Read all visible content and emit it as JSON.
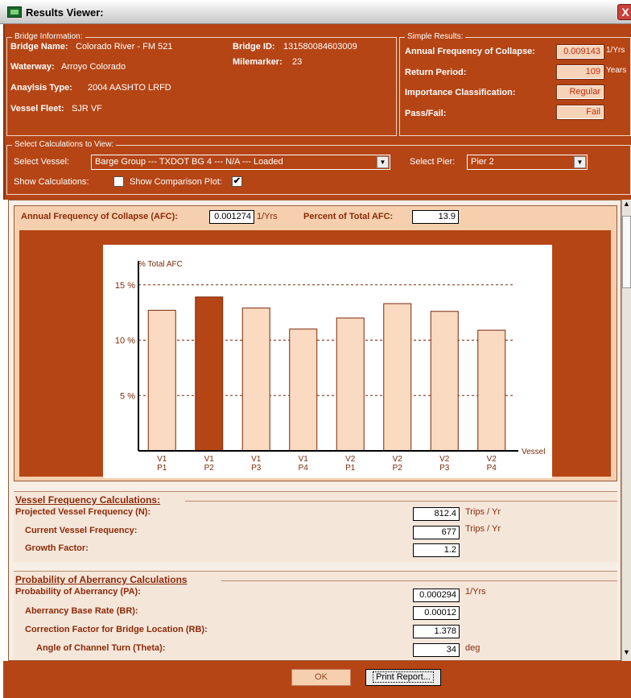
{
  "window": {
    "title": "Results Viewer:",
    "close_glyph": "X"
  },
  "bridge_info": {
    "group_title": "Bridge Information:",
    "name_label": "Bridge Name:",
    "name_value": "Colorado River - FM 521",
    "id_label": "Bridge ID:",
    "id_value": "131580084603009",
    "waterway_label": "Waterway:",
    "waterway_value": "Arroyo Colorado",
    "milemarker_label": "Milemarker:",
    "milemarker_value": "23",
    "analysis_label": "Anaylsis Type:",
    "analysis_value": "2004 AASHTO LRFD",
    "fleet_label": "Vessel Fleet:",
    "fleet_value": "SJR VF"
  },
  "simple_results": {
    "group_title": "Simple Results:",
    "afc_label": "Annual Frequency of Collapse:",
    "afc_value": "0.009143",
    "afc_unit": "1/Yrs",
    "return_label": "Return Period:",
    "return_value": "109",
    "return_unit": "Years",
    "importance_label": "Importance Classification:",
    "importance_value": "Regular",
    "passfail_label": "Pass/Fail:",
    "passfail_value": "Fail"
  },
  "select_calcs": {
    "group_title": "Select Calculations to View:",
    "vessel_label": "Select Vessel:",
    "vessel_value": "Barge Group --- TXDOT BG 4 --- N/A --- Loaded",
    "pier_label": "Select Pier:",
    "pier_value": "Pier 2",
    "show_calc_label": "Show Calculations:",
    "show_calc_checked": false,
    "show_comp_label": "Show Comparison Plot:",
    "show_comp_checked": true,
    "check_glyph": "✔"
  },
  "afc_panel": {
    "afc_label": "Annual Frequency of Collapse (AFC):",
    "afc_value": "0.001274",
    "afc_unit": "1/Yrs",
    "pct_label": "Percent of Total AFC:",
    "pct_value": "13.9"
  },
  "chart_data": {
    "type": "bar",
    "ylabel": "% Total AFC",
    "xlabel": "Vessel",
    "ylim": [
      0,
      16
    ],
    "yticks": [
      5,
      10,
      15
    ],
    "ytick_labels": [
      "5 %",
      "10 %",
      "15 %"
    ],
    "grid": "horizontal dashed",
    "categories": [
      {
        "top": "V1",
        "bottom": "P1"
      },
      {
        "top": "V1",
        "bottom": "P2"
      },
      {
        "top": "V1",
        "bottom": "P3"
      },
      {
        "top": "V1",
        "bottom": "P4"
      },
      {
        "top": "V2",
        "bottom": "P1"
      },
      {
        "top": "V2",
        "bottom": "P2"
      },
      {
        "top": "V2",
        "bottom": "P3"
      },
      {
        "top": "V2",
        "bottom": "P4"
      }
    ],
    "values": [
      12.7,
      13.9,
      12.9,
      11.0,
      12.0,
      13.3,
      12.6,
      10.9
    ],
    "highlight_index": 1,
    "colors": {
      "bar": "#fadac0",
      "highlight": "#b54515",
      "edge": "#7a2a08"
    }
  },
  "vessel_freq": {
    "title": "Vessel Frequency Calculations:",
    "rows": [
      {
        "label": "Projected Vessel Frequency (N):",
        "value": "812.4",
        "unit": "Trips / Yr"
      },
      {
        "label": "Current Vessel Frequency:",
        "value": "677",
        "unit": "Trips / Yr"
      },
      {
        "label": "Growth Factor:",
        "value": "1.2",
        "unit": ""
      }
    ]
  },
  "aberrancy": {
    "title": "Probability of Aberrancy Calculations",
    "rows": [
      {
        "label": "Probability of Aberrancy (PA):",
        "value": "0.000294",
        "unit": "1/Yrs"
      },
      {
        "label": "Aberrancy Base Rate (BR):",
        "value": "0.00012",
        "unit": ""
      },
      {
        "label": "Correction Factor for Bridge Location (RB):",
        "value": "1.378",
        "unit": ""
      },
      {
        "label": "Angle of Channel Turn (Theta):",
        "value": "34",
        "unit": "deg"
      }
    ]
  },
  "buttons": {
    "ok": "OK",
    "print": "Print Report..."
  },
  "colors": {
    "panel": "#b54515",
    "panel_text": "#ffffff",
    "value_box": "#f5d3b8",
    "dark_text": "#8a2a08"
  }
}
